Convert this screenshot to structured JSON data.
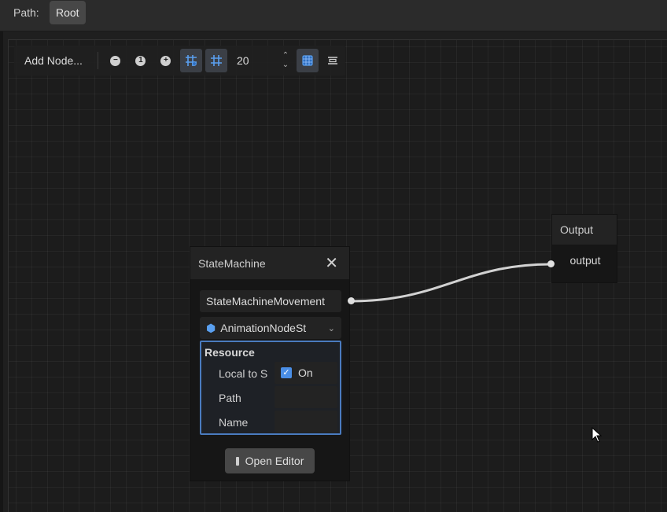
{
  "pathbar": {
    "label": "Path:",
    "crumb": "Root"
  },
  "toolbar": {
    "add_node": "Add Node...",
    "zoom_reset": "1",
    "snap_value": "20"
  },
  "state_machine_node": {
    "title": "StateMachine",
    "name_field": "StateMachineMovement",
    "resource_field": "AnimationNodeSt",
    "resource_section": "Resource",
    "props": {
      "local_label": "Local to S",
      "local_value": "On",
      "path_label": "Path",
      "path_value": "",
      "name_label": "Name",
      "name_value": ""
    },
    "open_editor": "Open Editor"
  },
  "output_node": {
    "title": "Output",
    "port_label": "output"
  },
  "colors": {
    "accent": "#4a8ee6",
    "resource_border": "#4a7bbf",
    "connection": "#d8d8d8"
  }
}
